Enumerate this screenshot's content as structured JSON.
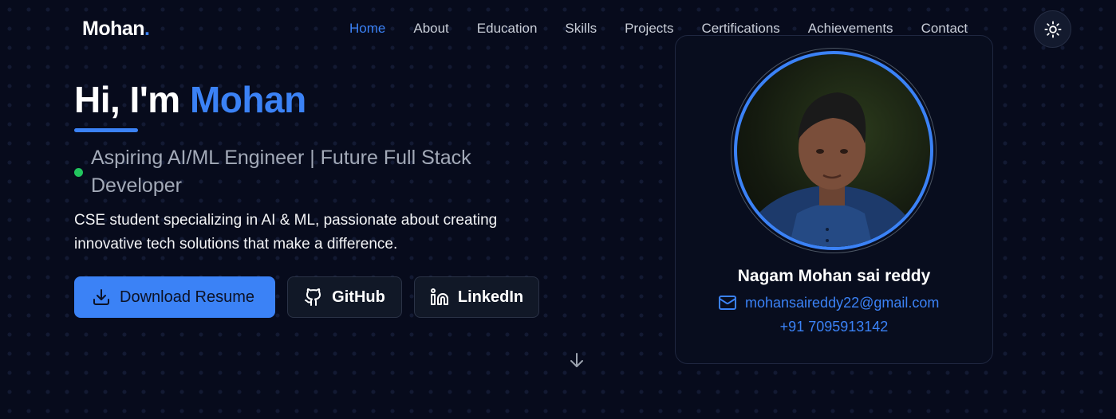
{
  "logo": {
    "text": "Mohan",
    "dot": "."
  },
  "nav": {
    "items": [
      {
        "label": "Home",
        "active": true
      },
      {
        "label": "About"
      },
      {
        "label": "Education"
      },
      {
        "label": "Skills"
      },
      {
        "label": "Projects"
      },
      {
        "label": "Certifications"
      },
      {
        "label": "Achievements"
      },
      {
        "label": "Contact"
      }
    ],
    "theme_toggle_icon": "sun-icon"
  },
  "hero": {
    "greeting": "Hi, I'm ",
    "name": "Mohan",
    "subtitle": "Aspiring AI/ML Engineer | Future Full Stack Developer",
    "description": "CSE student specializing in AI & ML, passionate about creating innovative tech solutions that make a difference.",
    "buttons": {
      "resume": {
        "label": "Download Resume",
        "icon": "download-icon"
      },
      "github": {
        "label": "GitHub",
        "icon": "github-icon"
      },
      "linkedin": {
        "label": "LinkedIn",
        "icon": "linkedin-icon"
      }
    },
    "scroll_icon": "arrow-down-icon"
  },
  "profile": {
    "name": "Nagam Mohan sai reddy",
    "email": "mohansaireddy22@gmail.com",
    "phone": "+91 7095913142",
    "email_icon": "mail-icon"
  },
  "colors": {
    "background": "#070b1c",
    "accent": "#3b82f6",
    "status": "#22c55e"
  }
}
